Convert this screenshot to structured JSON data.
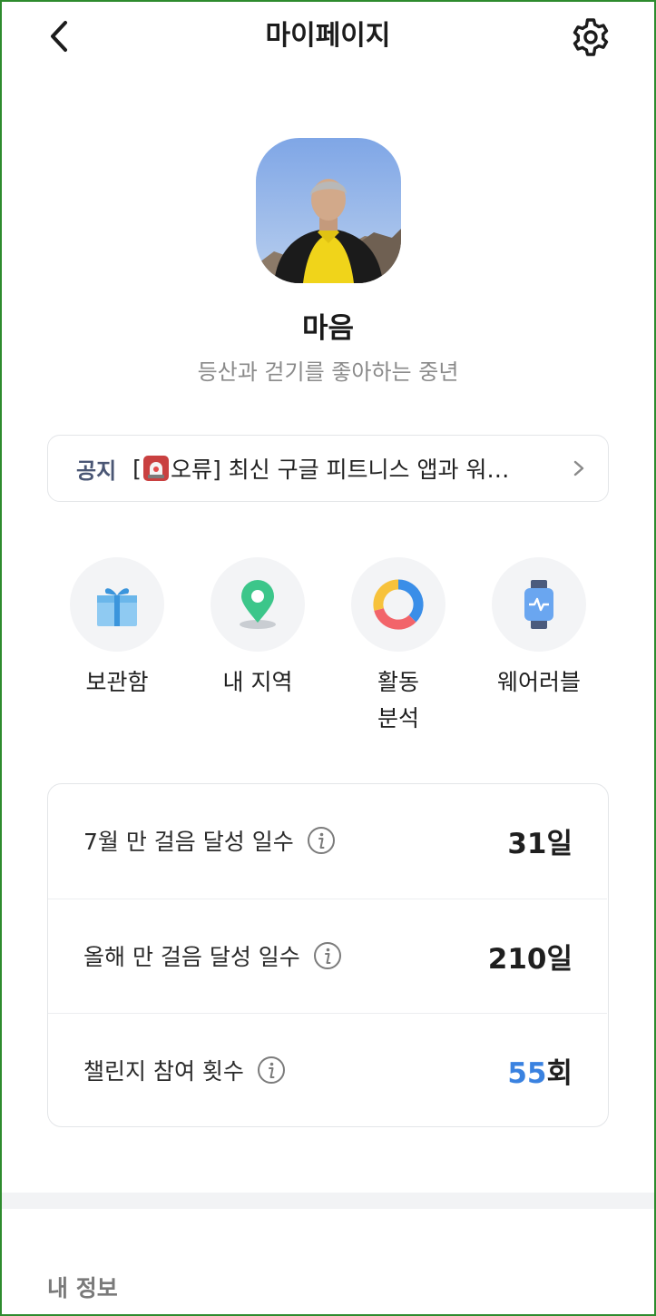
{
  "header": {
    "title": "마이페이지",
    "back_icon": "chevron-left-icon",
    "settings_icon": "gear-icon"
  },
  "profile": {
    "name": "마음",
    "bio": "등산과 걷기를 좋아하는 중년"
  },
  "notice": {
    "tag": "공지",
    "text_prefix": "[",
    "text_icon": "siren-icon",
    "text_rest": "오류] 최신 구글 피트니스 앱과 워…"
  },
  "quick_menu": [
    {
      "label": "보관함",
      "icon": "gift-icon"
    },
    {
      "label": "내 지역",
      "icon": "location-pin-icon"
    },
    {
      "label": "활동\n분석",
      "icon": "donut-chart-icon"
    },
    {
      "label": "웨어러블",
      "icon": "smartwatch-icon"
    }
  ],
  "stats": [
    {
      "label": "7월 만 걸음 달성 일수",
      "number": "31",
      "unit": "일"
    },
    {
      "label": "올해 만 걸음 달성 일수",
      "number": "210",
      "unit": "일"
    },
    {
      "label": "챌린지 참여 횟수",
      "number": "55",
      "unit": "회"
    }
  ],
  "section": {
    "title": "내 정보"
  },
  "colors": {
    "accent_blue": "#3a82e0",
    "notice_tag": "#4a5674",
    "frame": "#2e8b2e"
  }
}
